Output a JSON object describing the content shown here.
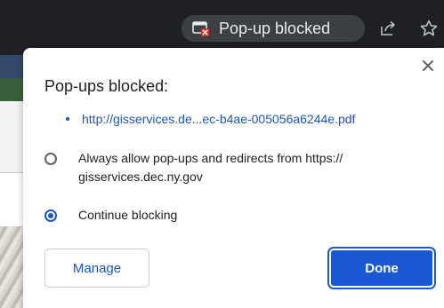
{
  "toolbar": {
    "chip_label": "Pop-up blocked",
    "chip_icon": "popup-blocked-icon",
    "share_icon": "share-icon",
    "bookmark_icon": "star-icon"
  },
  "dialog": {
    "title": "Pop-ups blocked:",
    "blocked_items": [
      {
        "url": "http://gisservices.de...ec-b4ae-005056a6244e.pdf"
      }
    ],
    "options": [
      {
        "label": "Always allow pop-ups and redirects from https:// gisservices.dec.ny.gov",
        "selected": false
      },
      {
        "label": "Continue blocking",
        "selected": true
      }
    ],
    "manage_label": "Manage",
    "done_label": "Done",
    "close_icon": "close-icon"
  },
  "colors": {
    "toolbar_bg": "#1f2023",
    "chip_bg": "#3c4043",
    "accent": "#1a57d2",
    "link": "#1a55c7"
  }
}
